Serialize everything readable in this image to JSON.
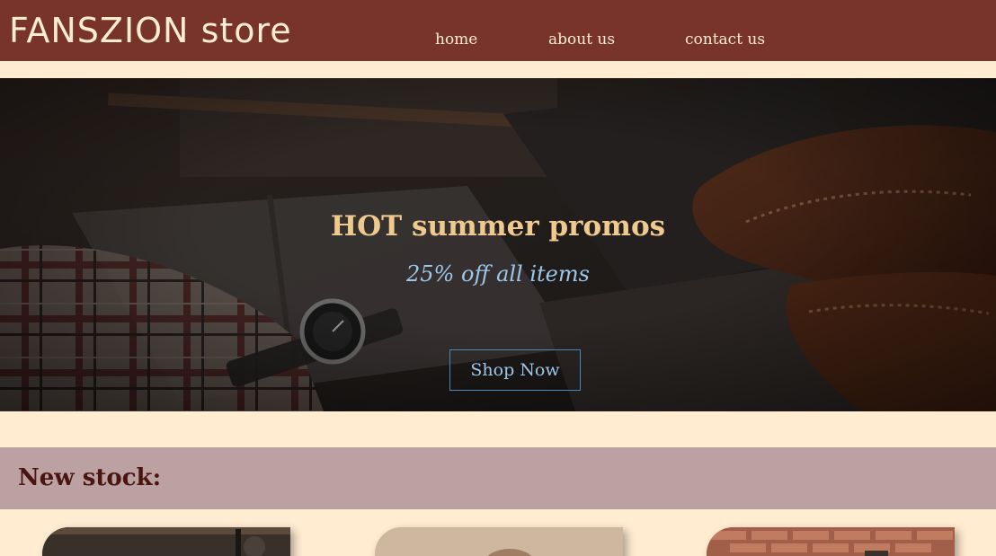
{
  "header": {
    "logo": "FANSZION store",
    "nav": [
      {
        "label": "home"
      },
      {
        "label": "about us"
      },
      {
        "label": "contact us"
      }
    ]
  },
  "hero": {
    "title": "HOT summer promos",
    "subtitle": "25% off all items",
    "cta_label": "Shop Now"
  },
  "new_stock": {
    "title": "New stock:",
    "items": [
      {
        "image": "product-photo"
      },
      {
        "image": "product-photo"
      },
      {
        "image": "product-photo"
      }
    ]
  },
  "colors": {
    "header_bg": "#78332a",
    "page_bg": "#ffecd1",
    "hero_title": "#f0c98e",
    "hero_subtitle": "#9cc7e8",
    "button_border": "#4a86b8",
    "stock_bar_bg": "#bba1a2",
    "stock_title": "#4a1510"
  }
}
